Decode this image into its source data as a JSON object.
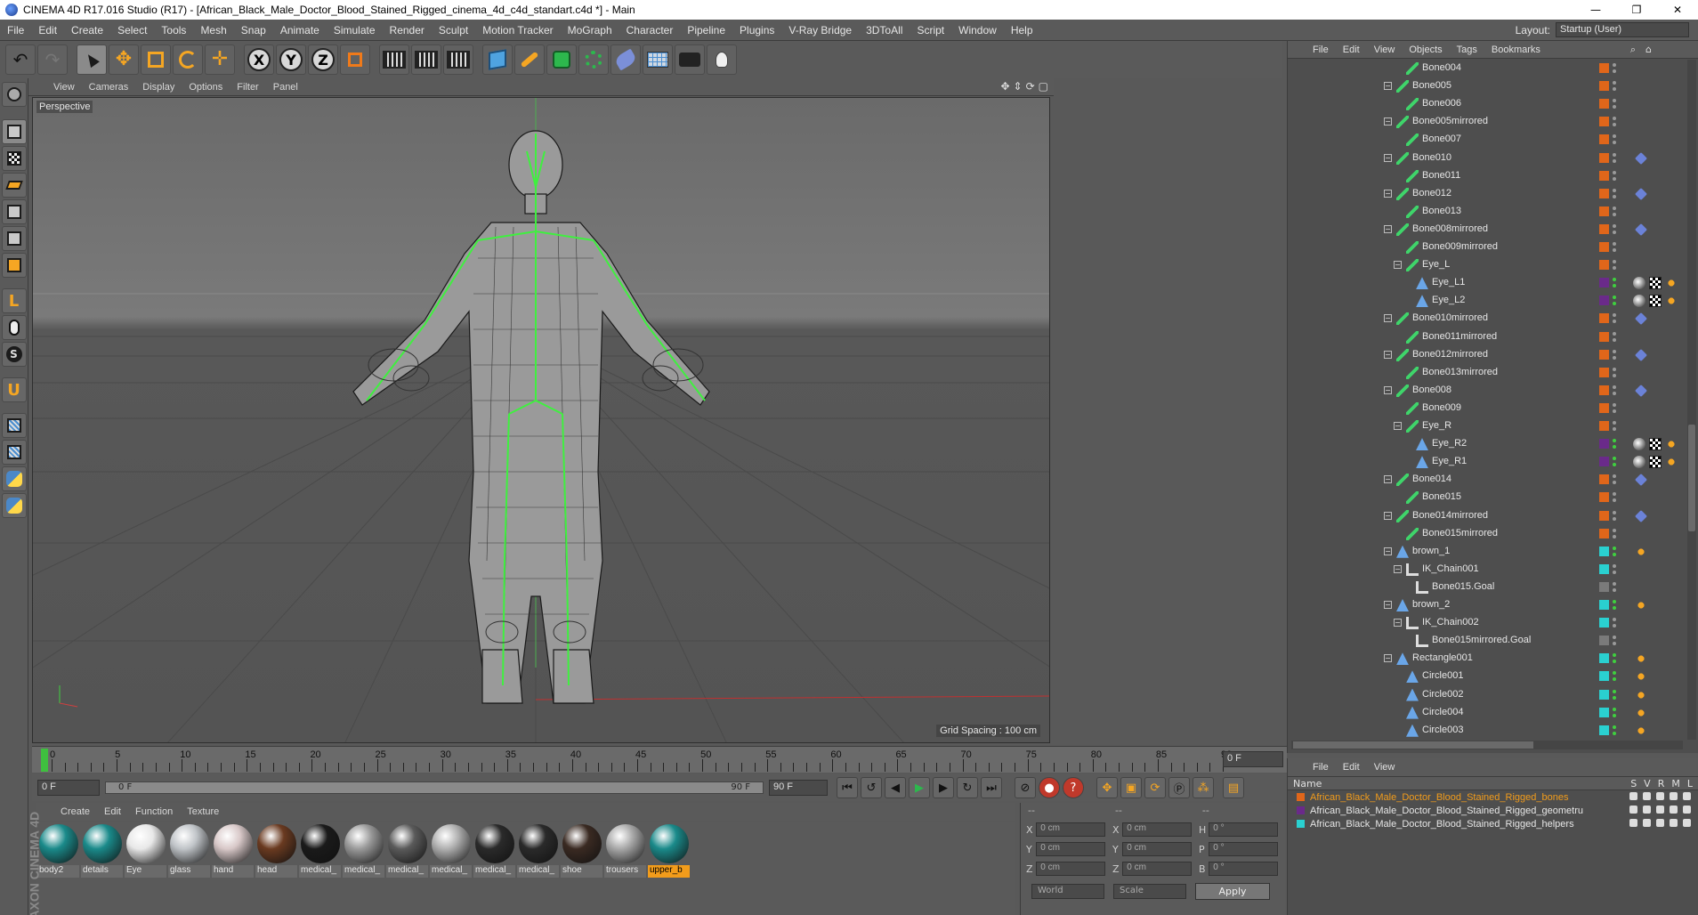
{
  "window": {
    "title": "CINEMA 4D R17.016 Studio (R17) - [African_Black_Male_Doctor_Blood_Stained_Rigged_cinema_4d_c4d_standart.c4d *] - Main",
    "controls": [
      "—",
      "❐",
      "✕"
    ]
  },
  "menubar": {
    "items": [
      "File",
      "Edit",
      "Create",
      "Select",
      "Tools",
      "Mesh",
      "Snap",
      "Animate",
      "Simulate",
      "Render",
      "Sculpt",
      "Motion Tracker",
      "MoGraph",
      "Character",
      "Pipeline",
      "Plugins",
      "V-Ray Bridge",
      "3DToAll",
      "Script",
      "Window",
      "Help"
    ],
    "layout_label": "Layout:",
    "layout_value": "Startup (User)"
  },
  "toolbar": {
    "axis_x": "X",
    "axis_y": "Y",
    "axis_z": "Z"
  },
  "viewport": {
    "menu": [
      "View",
      "Cameras",
      "Display",
      "Options",
      "Filter",
      "Panel"
    ],
    "label": "Perspective",
    "grid_spacing": "Grid Spacing : 100 cm"
  },
  "timeline": {
    "ticks": [
      "0",
      "5",
      "10",
      "15",
      "20",
      "25",
      "30",
      "35",
      "40",
      "45",
      "50",
      "55",
      "60",
      "65",
      "70",
      "75",
      "80",
      "85",
      "90"
    ],
    "current_frame": "0 F",
    "start_frame": "0 F",
    "range_start": "0 F",
    "range_end": "90 F",
    "end_frame": "90 F"
  },
  "material_manager": {
    "menu": [
      "Create",
      "Edit",
      "Function",
      "Texture"
    ],
    "materials": [
      {
        "name": "body2",
        "color": "#1a8a8a"
      },
      {
        "name": "details",
        "color": "#1a8a8a"
      },
      {
        "name": "Eye",
        "color": "#e8e8e8"
      },
      {
        "name": "glass",
        "color": "#c0c4c8"
      },
      {
        "name": "hand",
        "color": "#d8c8c8"
      },
      {
        "name": "head",
        "color": "#6a3a20"
      },
      {
        "name": "medical_",
        "color": "#1a1a1a"
      },
      {
        "name": "medical_",
        "color": "#9a9a9a"
      },
      {
        "name": "medical_",
        "color": "#5a5a5a"
      },
      {
        "name": "medical_",
        "color": "#b0b0b0"
      },
      {
        "name": "medical_",
        "color": "#2a2a2a"
      },
      {
        "name": "medical_",
        "color": "#2a2a2a"
      },
      {
        "name": "shoe",
        "color": "#3a2a22"
      },
      {
        "name": "trousers",
        "color": "#a8a8a8"
      },
      {
        "name": "upper_b",
        "color": "#1a8a8a"
      }
    ],
    "selected_index": 14
  },
  "coords": {
    "header": [
      "--",
      "--",
      "--"
    ],
    "rows": [
      {
        "a": "X",
        "v1": "0 cm",
        "b": "X",
        "v2": "0 cm",
        "c": "H",
        "v3": "0 °"
      },
      {
        "a": "Y",
        "v1": "0 cm",
        "b": "Y",
        "v2": "0 cm",
        "c": "P",
        "v3": "0 °"
      },
      {
        "a": "Z",
        "v1": "0 cm",
        "b": "Z",
        "v2": "0 cm",
        "c": "B",
        "v3": "0 °"
      }
    ],
    "mode_world": "World",
    "mode_scale": "Scale",
    "apply": "Apply"
  },
  "object_manager": {
    "menu": [
      "File",
      "Edit",
      "View",
      "Objects",
      "Tags",
      "Bookmarks"
    ],
    "rows": [
      {
        "name": "Bone004",
        "depth": 3,
        "type": "bone",
        "layer": "#e0661a",
        "tag": ""
      },
      {
        "name": "Bone005",
        "depth": 2,
        "type": "bone",
        "layer": "#e0661a",
        "tag": "",
        "exp": true
      },
      {
        "name": "Bone006",
        "depth": 3,
        "type": "bone",
        "layer": "#e0661a",
        "tag": ""
      },
      {
        "name": "Bone005mirrored",
        "depth": 2,
        "type": "bone",
        "layer": "#e0661a",
        "tag": "",
        "exp": true
      },
      {
        "name": "Bone007",
        "depth": 3,
        "type": "bone",
        "layer": "#e0661a",
        "tag": ""
      },
      {
        "name": "Bone010",
        "depth": 2,
        "type": "bone",
        "layer": "#e0661a",
        "tag": "ik",
        "exp": true
      },
      {
        "name": "Bone011",
        "depth": 3,
        "type": "bone",
        "layer": "#e0661a",
        "tag": ""
      },
      {
        "name": "Bone012",
        "depth": 2,
        "type": "bone",
        "layer": "#e0661a",
        "tag": "ik",
        "exp": true
      },
      {
        "name": "Bone013",
        "depth": 3,
        "type": "bone",
        "layer": "#e0661a",
        "tag": ""
      },
      {
        "name": "Bone008mirrored",
        "depth": 2,
        "type": "bone",
        "layer": "#e0661a",
        "tag": "ik",
        "exp": true
      },
      {
        "name": "Bone009mirrored",
        "depth": 3,
        "type": "bone",
        "layer": "#e0661a",
        "tag": ""
      },
      {
        "name": "Eye_L",
        "depth": 3,
        "type": "bone",
        "layer": "#e0661a",
        "tag": "",
        "exp": true
      },
      {
        "name": "Eye_L1",
        "depth": 4,
        "type": "joint",
        "layer": "#6a2a8a",
        "tag": "mat"
      },
      {
        "name": "Eye_L2",
        "depth": 4,
        "type": "joint",
        "layer": "#6a2a8a",
        "tag": "mat"
      },
      {
        "name": "Bone010mirrored",
        "depth": 2,
        "type": "bone",
        "layer": "#e0661a",
        "tag": "ik",
        "exp": true
      },
      {
        "name": "Bone011mirrored",
        "depth": 3,
        "type": "bone",
        "layer": "#e0661a",
        "tag": ""
      },
      {
        "name": "Bone012mirrored",
        "depth": 2,
        "type": "bone",
        "layer": "#e0661a",
        "tag": "ik",
        "exp": true
      },
      {
        "name": "Bone013mirrored",
        "depth": 3,
        "type": "bone",
        "layer": "#e0661a",
        "tag": ""
      },
      {
        "name": "Bone008",
        "depth": 2,
        "type": "bone",
        "layer": "#e0661a",
        "tag": "ik",
        "exp": true
      },
      {
        "name": "Bone009",
        "depth": 3,
        "type": "bone",
        "layer": "#e0661a",
        "tag": ""
      },
      {
        "name": "Eye_R",
        "depth": 3,
        "type": "bone",
        "layer": "#e0661a",
        "tag": "",
        "exp": true
      },
      {
        "name": "Eye_R2",
        "depth": 4,
        "type": "joint",
        "layer": "#6a2a8a",
        "tag": "mat"
      },
      {
        "name": "Eye_R1",
        "depth": 4,
        "type": "joint",
        "layer": "#6a2a8a",
        "tag": "mat"
      },
      {
        "name": "Bone014",
        "depth": 2,
        "type": "bone",
        "layer": "#e0661a",
        "tag": "ik",
        "exp": true
      },
      {
        "name": "Bone015",
        "depth": 3,
        "type": "bone",
        "layer": "#e0661a",
        "tag": ""
      },
      {
        "name": "Bone014mirrored",
        "depth": 2,
        "type": "bone",
        "layer": "#e0661a",
        "tag": "ik",
        "exp": true
      },
      {
        "name": "Bone015mirrored",
        "depth": 3,
        "type": "bone",
        "layer": "#e0661a",
        "tag": ""
      },
      {
        "name": "brown_1",
        "depth": 2,
        "type": "joint",
        "layer": "#2ad0d0",
        "tag": "constraint",
        "exp": true
      },
      {
        "name": "IK_Chain001",
        "depth": 3,
        "type": "ik",
        "layer": "#2ad0d0",
        "tag": "",
        "exp": true
      },
      {
        "name": "Bone015.Goal",
        "depth": 4,
        "type": "ik",
        "layer": "#7a7a7a",
        "tag": ""
      },
      {
        "name": "brown_2",
        "depth": 2,
        "type": "joint",
        "layer": "#2ad0d0",
        "tag": "constraint",
        "exp": true
      },
      {
        "name": "IK_Chain002",
        "depth": 3,
        "type": "ik",
        "layer": "#2ad0d0",
        "tag": "",
        "exp": true
      },
      {
        "name": "Bone015mirrored.Goal",
        "depth": 4,
        "type": "ik",
        "layer": "#7a7a7a",
        "tag": ""
      },
      {
        "name": "Rectangle001",
        "depth": 2,
        "type": "joint",
        "layer": "#2ad0d0",
        "tag": "constraint",
        "exp": true
      },
      {
        "name": "Circle001",
        "depth": 3,
        "type": "joint",
        "layer": "#2ad0d0",
        "tag": "constraint"
      },
      {
        "name": "Circle002",
        "depth": 3,
        "type": "joint",
        "layer": "#2ad0d0",
        "tag": "constraint"
      },
      {
        "name": "Circle004",
        "depth": 3,
        "type": "joint",
        "layer": "#2ad0d0",
        "tag": "constraint"
      },
      {
        "name": "Circle003",
        "depth": 3,
        "type": "joint",
        "layer": "#2ad0d0",
        "tag": "constraint"
      }
    ]
  },
  "layer_manager": {
    "menu": [
      "File",
      "Edit",
      "View"
    ],
    "header_name": "Name",
    "header_cols": [
      "S",
      "V",
      "R",
      "M",
      "L"
    ],
    "layers": [
      {
        "name": "African_Black_Male_Doctor_Blood_Stained_Rigged_bones",
        "color": "#e0661a",
        "selected": true
      },
      {
        "name": "African_Black_Male_Doctor_Blood_Stained_Rigged_geometru",
        "color": "#6a2a8a",
        "selected": false
      },
      {
        "name": "African_Black_Male_Doctor_Blood_Stained_Rigged_helpers",
        "color": "#2ad0d0",
        "selected": false
      }
    ]
  },
  "brand": "MAXON CINEMA 4D"
}
